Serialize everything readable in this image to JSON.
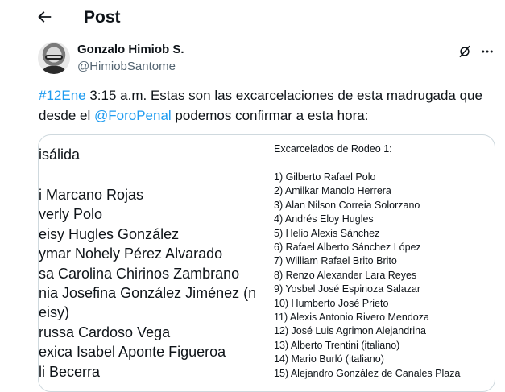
{
  "header": {
    "title": "Post",
    "back_icon": "arrow-left-icon"
  },
  "author": {
    "name": "Gonzalo Himiob S.",
    "handle": "@HimiobSantome",
    "avatar_icon": "user-avatar"
  },
  "post": {
    "hashtag": "#12Ene",
    "text_1": " 3:15 a.m. Estas son las excarcelaciones de esta madrugada que desde el ",
    "mention": "@ForoPenal",
    "text_2": " podemos confirmar a esta hora:"
  },
  "image": {
    "left_title": "isálida",
    "left_lines": [
      "i Marcano Rojas",
      "verly Polo",
      "eisy Hugles González",
      "ymar Nohely Pérez Alvarado",
      "sa Carolina Chirinos Zambrano",
      "nia Josefina González Jiménez (n",
      "eisy)",
      "russa Cardoso Vega",
      "exica Isabel Aponte Figueroa",
      "li Becerra"
    ],
    "right_title": "Excarcelados de Rodeo 1:",
    "right_lines": [
      "1) Gilberto Rafael Polo",
      "2) Amilkar Manolo Herrera",
      "3) Alan Nilson Correia Solorzano",
      "4) Andrés Eloy Hugles",
      "5) Helio Alexis Sánchez",
      "6) Rafael Alberto Sánchez López",
      "7) William Rafael Brito Brito",
      "8) Renzo Alexander Lara Reyes",
      "9) Yosbel José Espinoza Salazar",
      "10) Humberto José Prieto",
      "11) Alexis Antonio Rivero Mendoza",
      "12) José Luis Agrimon Alejandrina",
      "13) Alberto Trentini (italiano)",
      "14) Mario Burló (italiano)",
      "15) Alejandro González de Canales Plaza"
    ]
  },
  "colors": {
    "accent": "#1d9bf0",
    "text": "#0f1419",
    "muted": "#536471",
    "border": "#cfd9de"
  },
  "icons": {
    "grok": "grok-icon",
    "more": "more-dots-icon"
  }
}
